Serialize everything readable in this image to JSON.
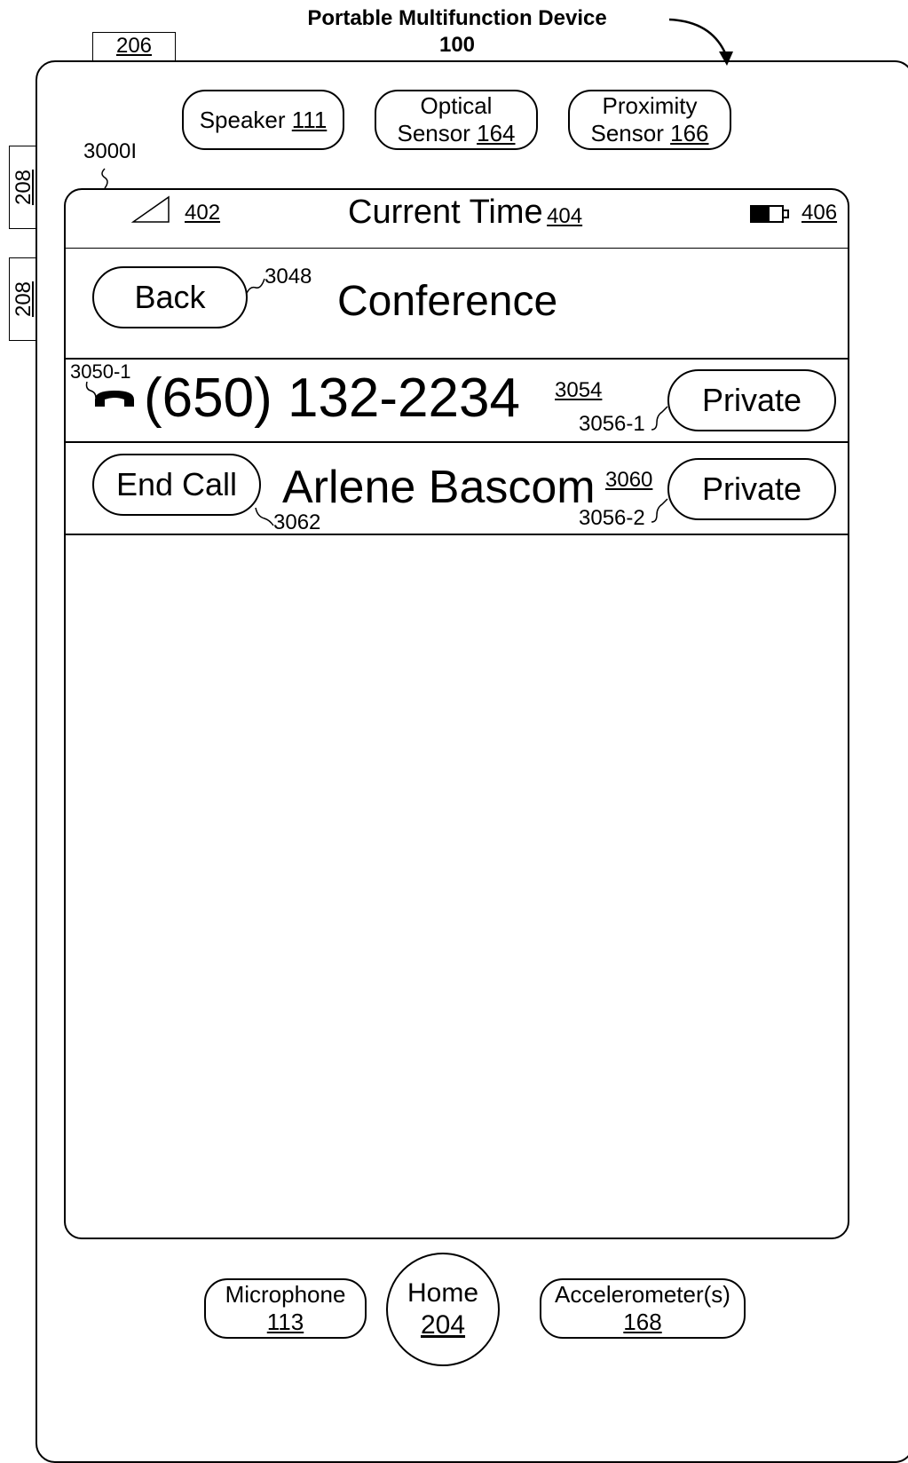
{
  "device": {
    "title": "Portable Multifunction Device",
    "number": "100"
  },
  "labels": {
    "side_button_top": "206",
    "side_button_left_1": "208",
    "side_button_left_2": "208",
    "screen_ref": "3000I"
  },
  "hardware_top": {
    "speaker": {
      "label": "Speaker",
      "ref": "111"
    },
    "optical": {
      "label1": "Optical",
      "label2": "Sensor",
      "ref": "164"
    },
    "proximity": {
      "label1": "Proximity",
      "label2": "Sensor",
      "ref": "166"
    }
  },
  "status_bar": {
    "signal_ref": "402",
    "time_label": "Current Time",
    "time_ref": "404",
    "battery_ref": "406"
  },
  "nav": {
    "back_label": "Back",
    "back_ref": "3048",
    "title": "Conference"
  },
  "call_rows": [
    {
      "icon_ref": "3050-1",
      "number": "(650) 132-2234",
      "number_ref": "3054",
      "private_label": "Private",
      "private_ref": "3056-1"
    },
    {
      "end_call_label": "End Call",
      "end_call_ref": "3062",
      "name": "Arlene Bascom",
      "name_ref": "3060",
      "private_label": "Private",
      "private_ref": "3056-2"
    }
  ],
  "hardware_bottom": {
    "microphone": {
      "label": "Microphone",
      "ref": "113"
    },
    "home": {
      "label": "Home",
      "ref": "204"
    },
    "accelerometer": {
      "label": "Accelerometer(s)",
      "ref": "168"
    }
  }
}
